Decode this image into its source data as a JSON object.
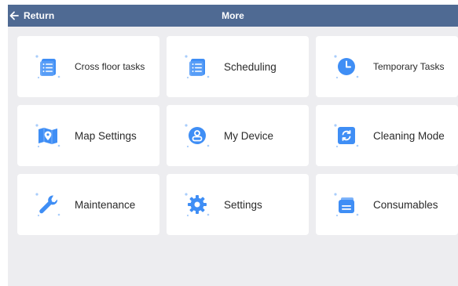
{
  "header": {
    "back_label": "Return",
    "title": "More"
  },
  "colors": {
    "header_bg": "#4f6a93",
    "background": "#ededf0",
    "card_bg": "#ffffff",
    "icon_primary": "#3f8ef5",
    "icon_light": "#a9cdfb"
  },
  "menu": [
    {
      "label": "Cross floor tasks",
      "icon": "task-list-icon"
    },
    {
      "label": "Scheduling",
      "icon": "schedule-list-icon"
    },
    {
      "label": "Temporary Tasks",
      "icon": "clock-icon"
    },
    {
      "label": "Map Settings",
      "icon": "map-pin-icon"
    },
    {
      "label": "My Device",
      "icon": "device-user-icon"
    },
    {
      "label": "Cleaning Mode",
      "icon": "cleaning-mode-icon"
    },
    {
      "label": "Maintenance",
      "icon": "wrench-icon"
    },
    {
      "label": "Settings",
      "icon": "gear-icon"
    },
    {
      "label": "Consumables",
      "icon": "consumables-icon"
    }
  ]
}
